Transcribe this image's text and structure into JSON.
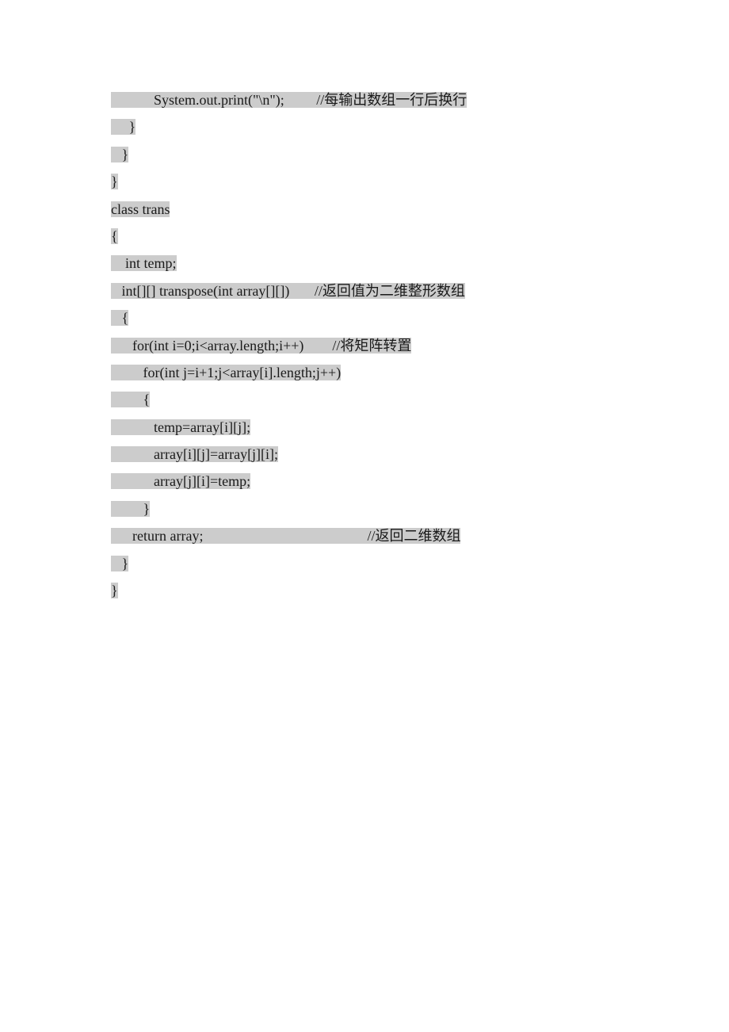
{
  "code_lines": [
    {
      "text": "            System.out.print(\"\\n\");         ",
      "comment": "//每输出数组一行后换行",
      "highlighted": true
    },
    {
      "text": "     }",
      "highlighted": true
    },
    {
      "text": "   }",
      "highlighted": true
    },
    {
      "text": "}",
      "highlighted": true
    },
    {
      "text": "class trans",
      "highlighted": true
    },
    {
      "text": "{",
      "highlighted": true
    },
    {
      "text": "    int temp;",
      "highlighted": true
    },
    {
      "text": "   int[][] transpose(int array[][])       ",
      "comment": "//返回值为二维整形数组",
      "highlighted": true
    },
    {
      "text": "   {",
      "highlighted": true
    },
    {
      "text": "      for(int i=0;i<array.length;i++)        ",
      "comment": "//将矩阵转置",
      "highlighted": true
    },
    {
      "text": "         for(int j=i+1;j<array[i].length;j++)",
      "highlighted": true
    },
    {
      "text": "         {",
      "highlighted": true
    },
    {
      "text": "            temp=array[i][j];",
      "highlighted": true
    },
    {
      "text": "            array[i][j]=array[j][i];",
      "highlighted": true
    },
    {
      "text": "            array[j][i]=temp;",
      "highlighted": true
    },
    {
      "text": "         }",
      "highlighted": true
    },
    {
      "text": "      return array;                                              ",
      "comment": "//返回二维数组",
      "highlighted": true
    },
    {
      "text": "   }",
      "highlighted": true
    },
    {
      "text": "}",
      "highlighted": true
    }
  ]
}
